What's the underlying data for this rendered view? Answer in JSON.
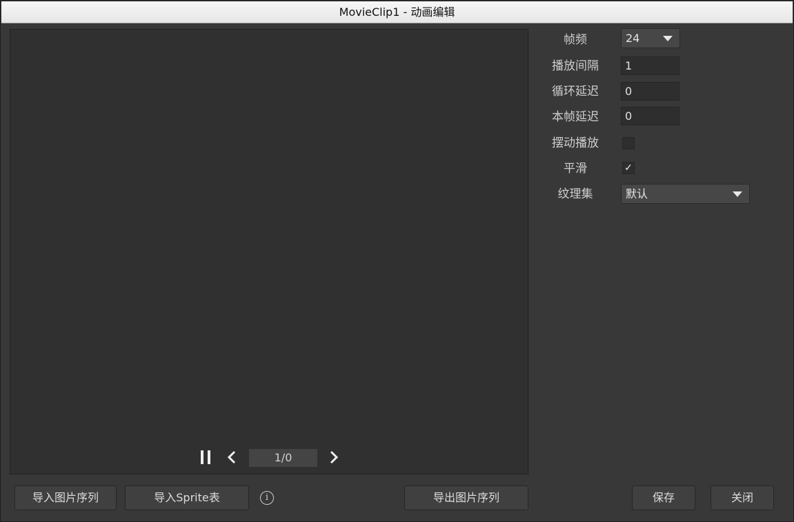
{
  "window": {
    "title": "MovieClip1 - 动画编辑"
  },
  "playback": {
    "pause_icon": "pause-icon",
    "prev_icon": "chevron-left-icon",
    "next_icon": "chevron-right-icon",
    "frame_counter": "1/0"
  },
  "properties": {
    "fps": {
      "label": "帧频",
      "value": "24"
    },
    "play_interval": {
      "label": "播放间隔",
      "value": "1"
    },
    "loop_delay": {
      "label": "循环延迟",
      "value": "0"
    },
    "frame_delay": {
      "label": "本帧延迟",
      "value": "0"
    },
    "swing": {
      "label": "摆动播放",
      "checked": false
    },
    "smooth": {
      "label": "平滑",
      "checked": true,
      "mark": "✓"
    },
    "atlas": {
      "label": "纹理集",
      "value": "默认"
    }
  },
  "buttons": {
    "import_sequence": "导入图片序列",
    "import_sprite": "导入Sprite表",
    "info": "i",
    "export_sequence": "导出图片序列",
    "save": "保存",
    "close": "关闭"
  },
  "colors": {
    "background": "#383838",
    "preview": "#303030",
    "titlebar": "#f0f0f0"
  }
}
